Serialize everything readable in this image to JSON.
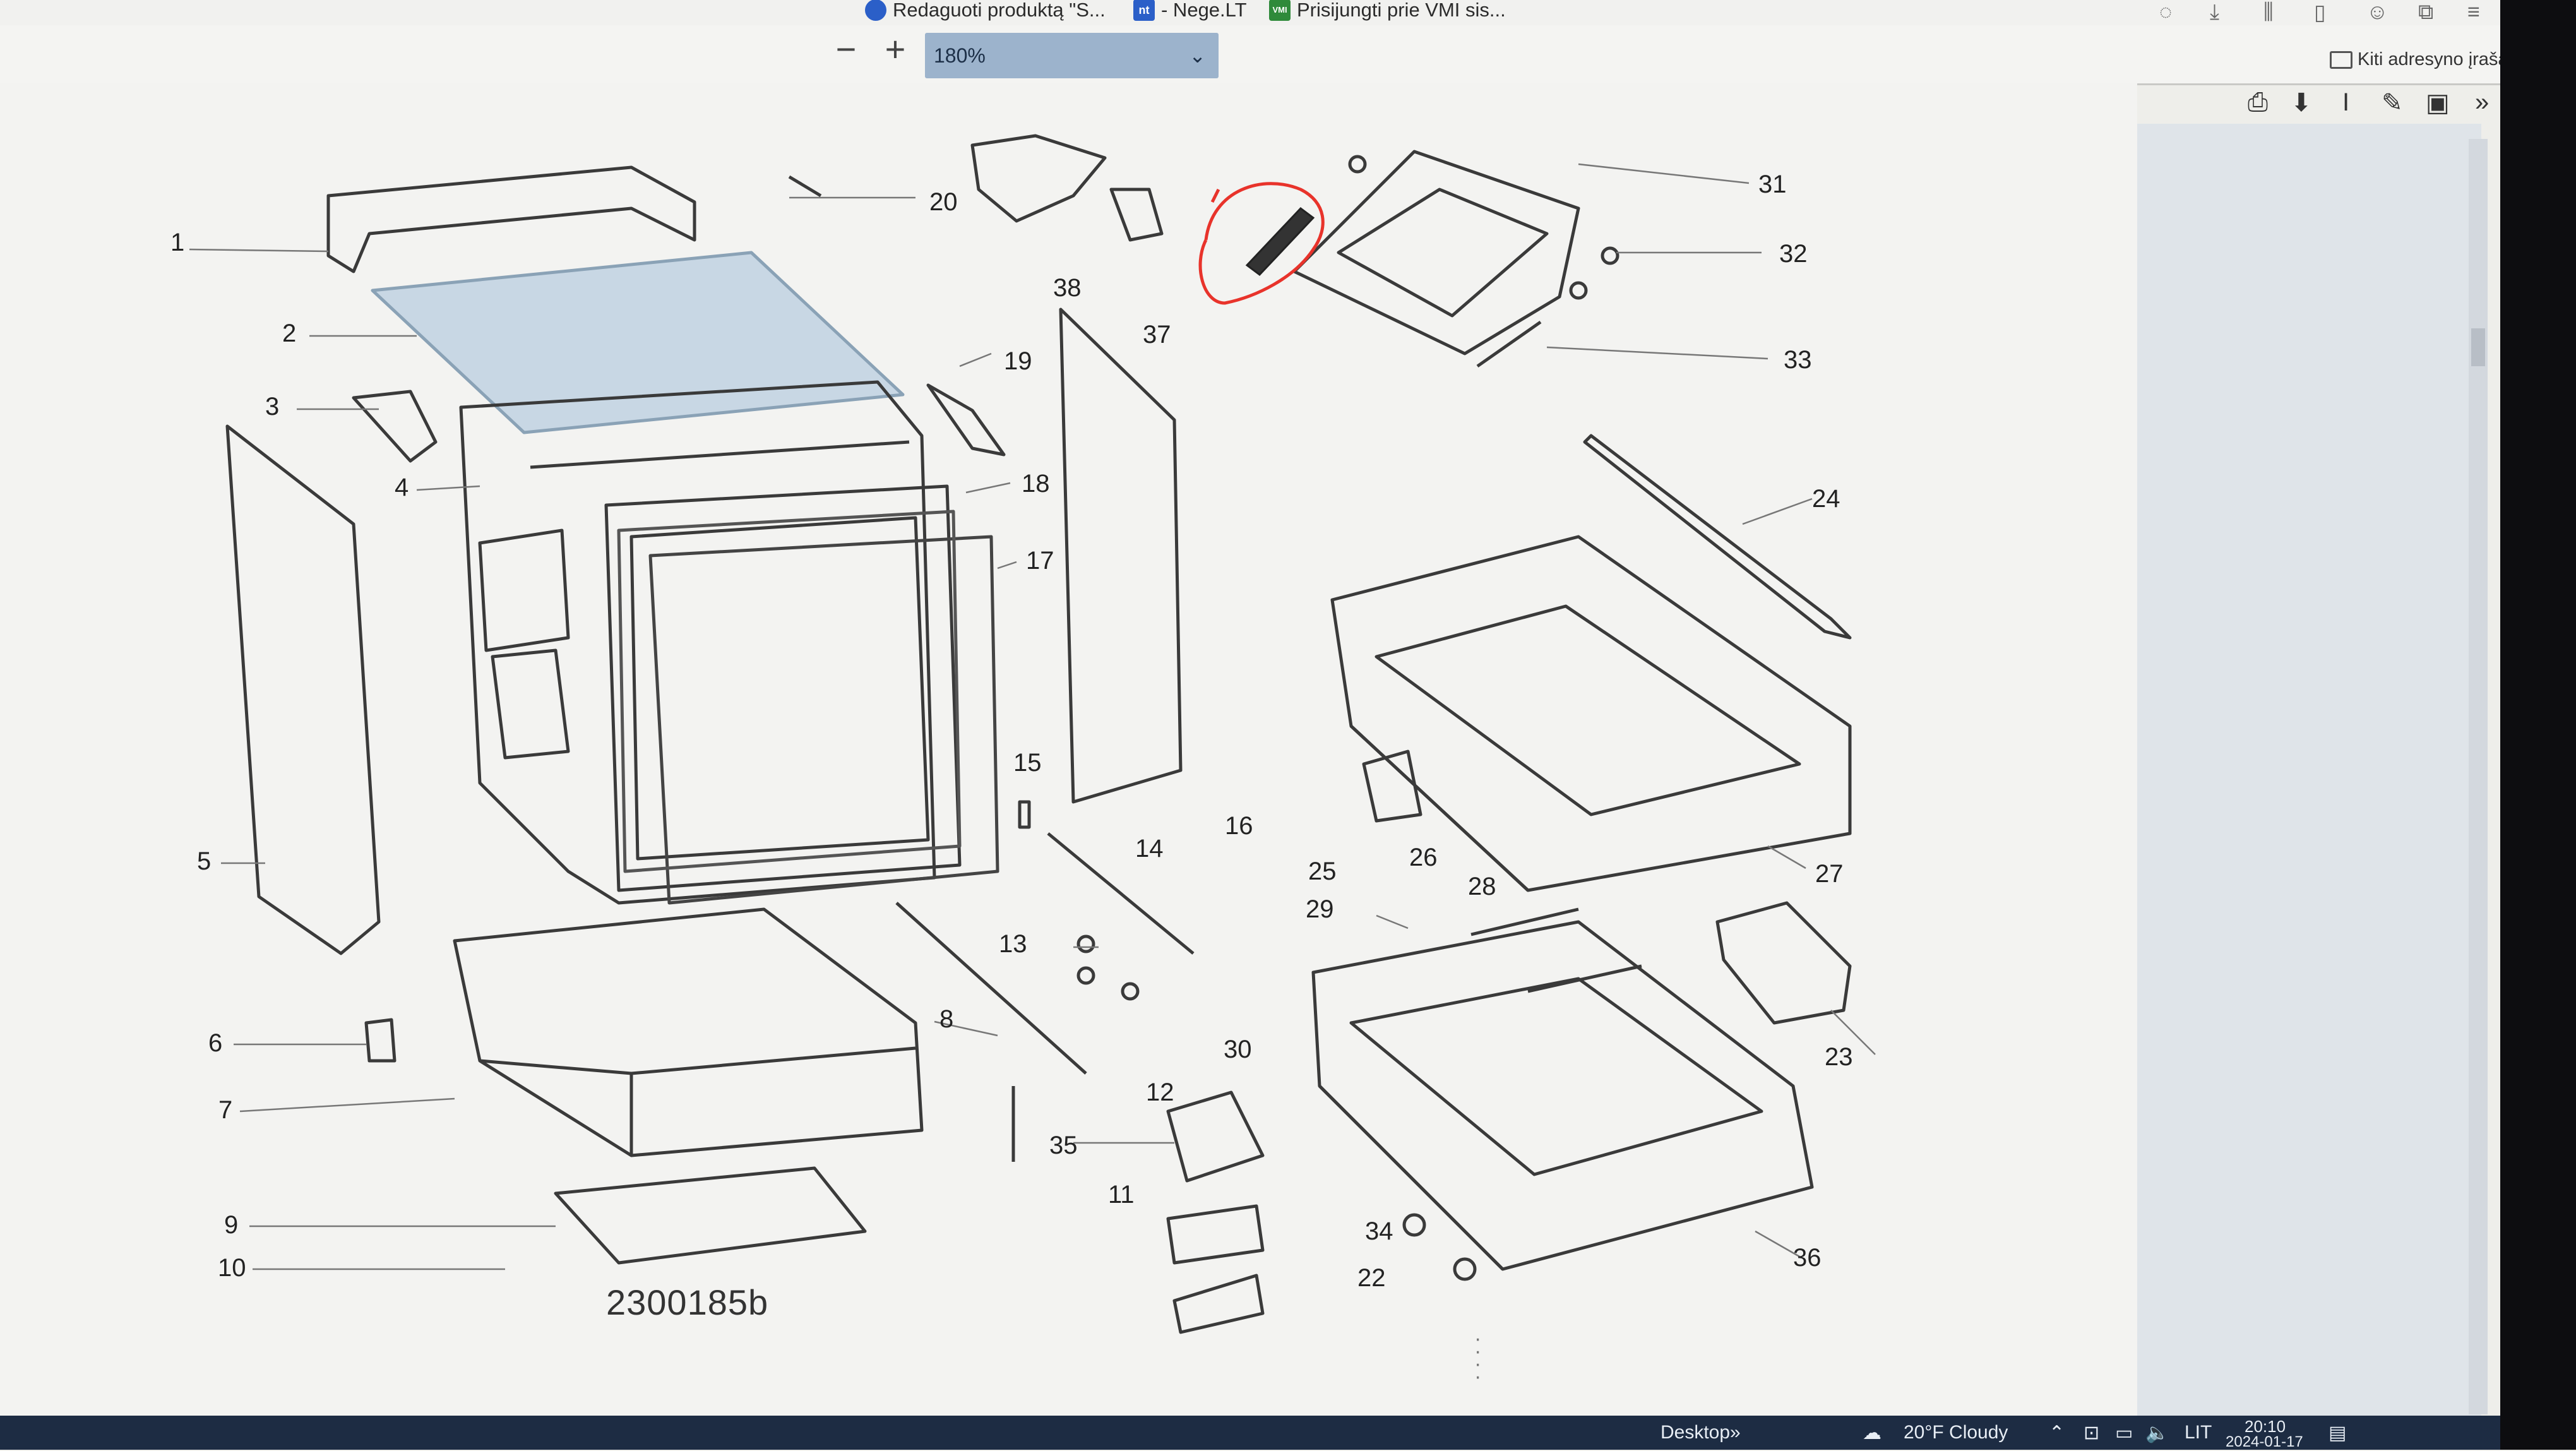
{
  "bookmarks": [
    {
      "label": "Redaguoti produktą \"S...",
      "icon_color": "#2b5fc8",
      "icon_text": ""
    },
    {
      "label": "- Nege.LT",
      "icon_color": "#2b5fc8",
      "icon_text": "nt"
    },
    {
      "label": "Prisijungti prie VMI sis...",
      "icon_color": "#2f8a3a",
      "icon_text": "VMI"
    }
  ],
  "toolbar": {
    "zoom_out": "−",
    "zoom_in": "+",
    "zoom_value": "180%",
    "other_bookmarks": "Kiti adresyno įrašai"
  },
  "pdf_tools": [
    "print-icon",
    "download-icon",
    "text-select-icon",
    "pen-icon",
    "image-icon",
    "more-icon"
  ],
  "diagram": {
    "doc_number": "2300185b",
    "highlight_color": "#e8332b",
    "callouts": [
      "1",
      "2",
      "3",
      "4",
      "5",
      "6",
      "7",
      "8",
      "9",
      "10",
      "11",
      "12",
      "13",
      "14",
      "15",
      "16",
      "17",
      "18",
      "19",
      "20",
      "22",
      "23",
      "24",
      "25",
      "26",
      "27",
      "28",
      "29",
      "30",
      "31",
      "32",
      "33",
      "34",
      "35",
      "36",
      "37",
      "38"
    ]
  },
  "taskbar": {
    "desktop": "Desktop",
    "more": "»",
    "weather": "20°F  Cloudy",
    "lang": "LIT",
    "time": "20:10",
    "date": "2024-01-17"
  }
}
